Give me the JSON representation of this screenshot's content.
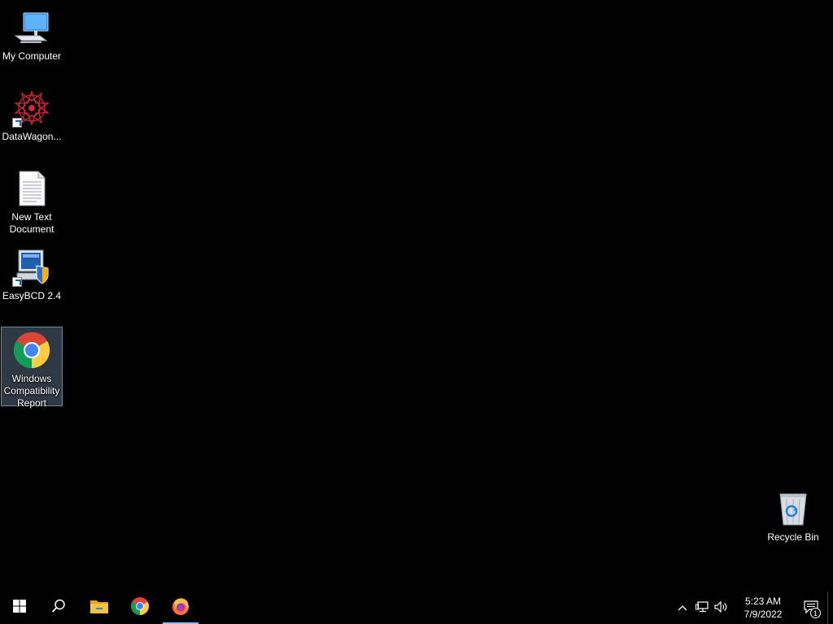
{
  "desktop": {
    "icons": [
      {
        "label": "My Computer",
        "icon": "computer-icon"
      },
      {
        "label": "DataWagon...",
        "icon": "datawagon-icon"
      },
      {
        "label": "New Text Document",
        "icon": "text-document-icon"
      },
      {
        "label": "EasyBCD 2.4",
        "icon": "easybcd-icon"
      },
      {
        "label": "Windows Compatibility Report",
        "icon": "chrome-icon"
      },
      {
        "label": "Recycle Bin",
        "icon": "recycle-bin-icon"
      }
    ],
    "selected_index": 4
  },
  "taskbar": {
    "apps": [
      {
        "name": "Start",
        "icon": "windows-start-icon"
      },
      {
        "name": "Search",
        "icon": "search-icon"
      },
      {
        "name": "File Explorer",
        "icon": "folder-icon"
      },
      {
        "name": "Google Chrome",
        "icon": "chrome-icon"
      },
      {
        "name": "Firefox",
        "icon": "firefox-icon",
        "active": true
      }
    ],
    "tray": {
      "chevron": "^",
      "time": "5:23 AM",
      "date": "7/9/2022",
      "notification_count": "1"
    }
  },
  "colors": {
    "background": "#000000",
    "selection": "#5f7d9a",
    "taskbar_active": "#7fc6ff"
  }
}
